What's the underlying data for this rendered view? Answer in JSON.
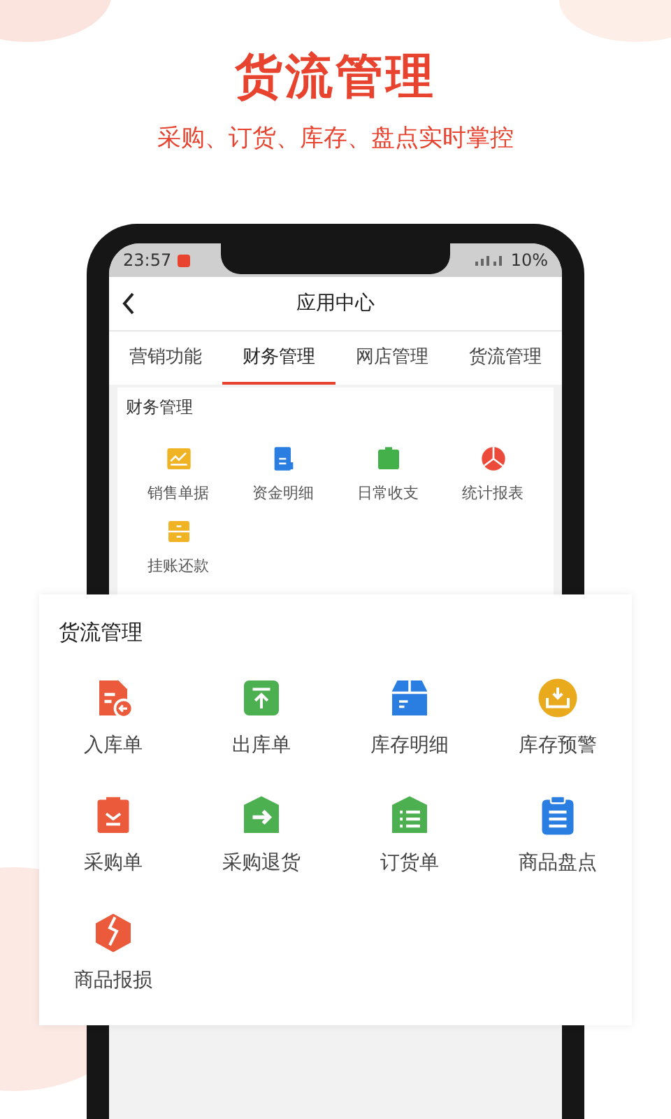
{
  "header": {
    "title": "货流管理",
    "subtitle": "采购、订货、库存、盘点实时掌控"
  },
  "phone": {
    "status_bar": {
      "time": "23:57",
      "battery": "10%"
    },
    "nav": {
      "title": "应用中心"
    },
    "tabs": [
      {
        "label": "营销功能",
        "selected": false
      },
      {
        "label": "财务管理",
        "selected": true
      },
      {
        "label": "网店管理",
        "selected": false
      },
      {
        "label": "货流管理",
        "selected": false
      }
    ],
    "section": {
      "title": "财务管理",
      "items": [
        {
          "label": "销售单据"
        },
        {
          "label": "资金明细"
        },
        {
          "label": "日常收支"
        },
        {
          "label": "统计报表"
        },
        {
          "label": "挂账还款"
        }
      ]
    }
  },
  "overlay": {
    "title": "货流管理",
    "items": [
      {
        "label": "入库单"
      },
      {
        "label": "出库单"
      },
      {
        "label": "库存明细"
      },
      {
        "label": "库存预警"
      },
      {
        "label": "采购单"
      },
      {
        "label": "采购退货"
      },
      {
        "label": "订货单"
      },
      {
        "label": "商品盘点"
      },
      {
        "label": "商品报损"
      }
    ]
  }
}
